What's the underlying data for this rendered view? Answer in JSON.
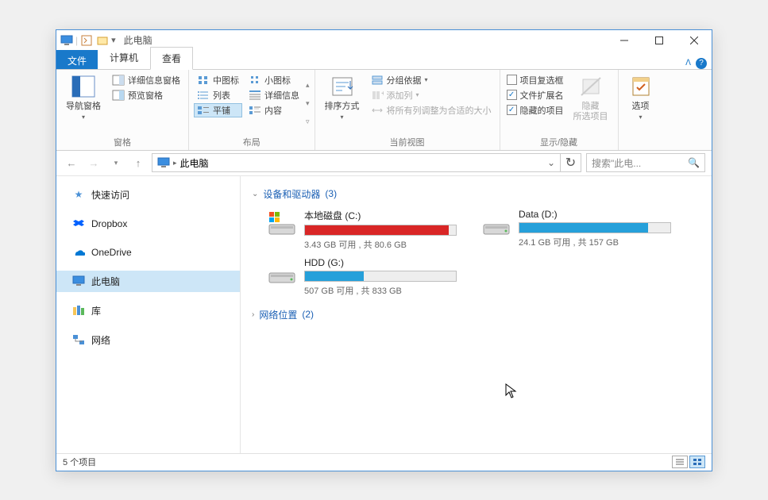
{
  "title": "此电脑",
  "tabs": {
    "file": "文件",
    "computer": "计算机",
    "view": "查看"
  },
  "ribbon": {
    "panes": {
      "label": "窗格",
      "nav": "导航窗格",
      "detail_pane": "详细信息窗格",
      "preview": "预览窗格"
    },
    "layout": {
      "label": "布局",
      "medium": "中图标",
      "small": "小图标",
      "list": "列表",
      "details": "详细信息",
      "tiles": "平铺",
      "content": "内容"
    },
    "current_view": {
      "label": "当前视图",
      "sort": "排序方式",
      "group": "分组依据",
      "add_col": "添加列",
      "fit": "将所有列调整为合适的大小"
    },
    "show_hide": {
      "label": "显示/隐藏",
      "checkboxes": "项目复选框",
      "extensions": "文件扩展名",
      "hidden": "隐藏的项目",
      "hide": "隐藏",
      "hide_sub": "所选项目"
    },
    "options": "选项"
  },
  "address": {
    "location": "此电脑"
  },
  "search": {
    "placeholder": "搜索\"此电..."
  },
  "nav": {
    "quick": "快速访问",
    "dropbox": "Dropbox",
    "onedrive": "OneDrive",
    "this_pc": "此电脑",
    "libraries": "库",
    "network": "网络"
  },
  "groups": {
    "drives": {
      "label": "设备和驱动器",
      "count": "(3)"
    },
    "network": {
      "label": "网络位置",
      "count": "(2)"
    }
  },
  "drives": [
    {
      "name": "本地磁盘 (C:)",
      "stats": "3.43 GB 可用 , 共 80.6 GB",
      "fill_pct": 95,
      "color": "#d92626",
      "type": "system"
    },
    {
      "name": "Data (D:)",
      "stats": "24.1 GB 可用 , 共 157 GB",
      "fill_pct": 85,
      "color": "#26a0da",
      "type": "data"
    },
    {
      "name": "HDD (G:)",
      "stats": "507 GB 可用 , 共 833 GB",
      "fill_pct": 39,
      "color": "#26a0da",
      "type": "data"
    }
  ],
  "status": {
    "items": "5 个项目"
  }
}
